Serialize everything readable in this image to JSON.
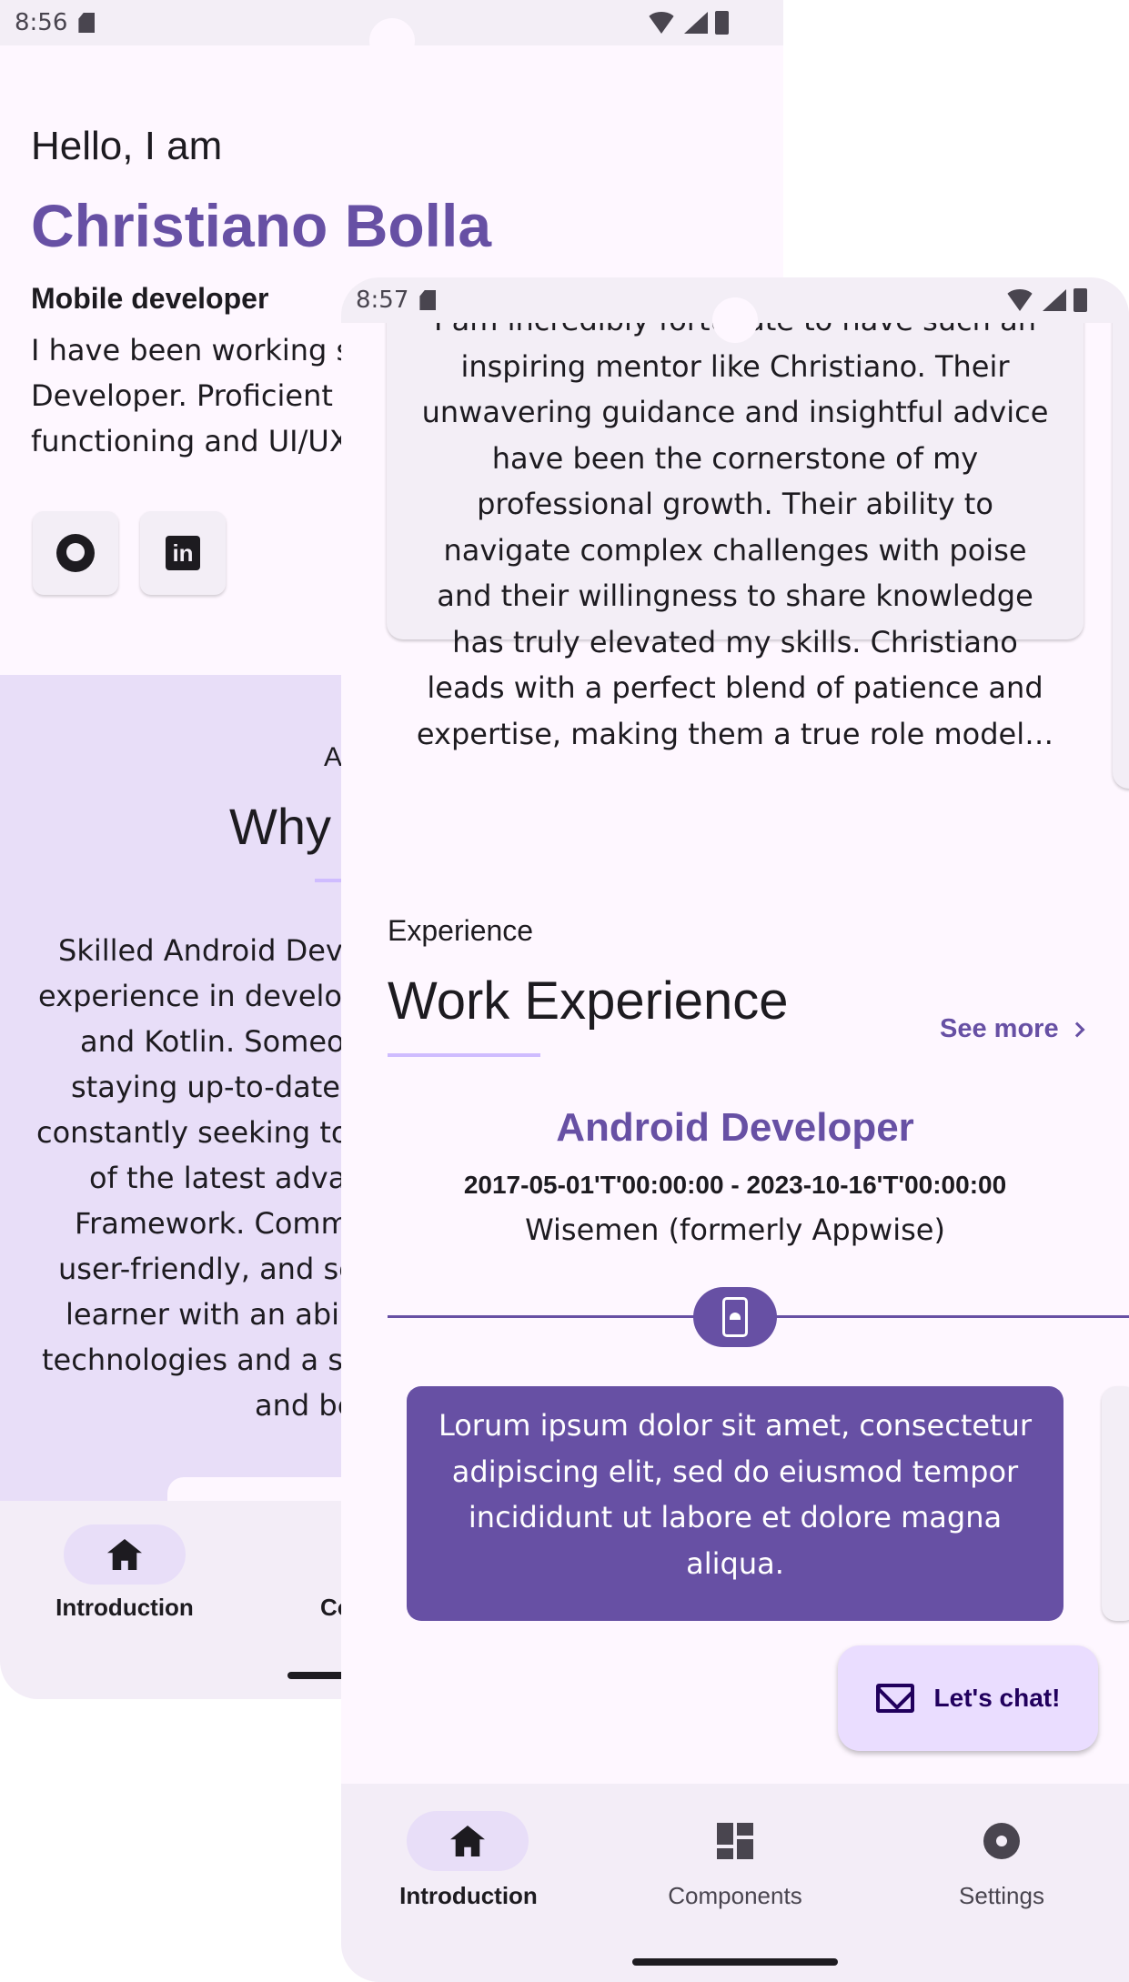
{
  "phone1": {
    "status": {
      "time": "8:56"
    },
    "intro": {
      "greeting": "Hello, I am",
      "name": "Christiano Bolla",
      "role": "Mobile developer",
      "bio": "I have been working s\nDeveloper. Proficient\nfunctioning and UI/UX"
    },
    "social": [
      {
        "icon": "github-icon"
      },
      {
        "icon": "linkedin-icon",
        "glyph": "in"
      }
    ],
    "about": {
      "label": "A",
      "title": "Why",
      "lines": [
        "Skilled Android Dev",
        "experience in develop",
        "and Kotlin. Someo",
        "staying up-to-date v",
        "constantly seeking to",
        "of the latest adva",
        "Framework. Comm",
        "user-friendly, and sc",
        "learner with an abil",
        "technologies and a s",
        "and be"
      ]
    },
    "nav": {
      "introduction": "Introduction",
      "components_partial": "Co"
    }
  },
  "phone2": {
    "status": {
      "time": "8:57"
    },
    "testimonial": {
      "text": "I am incredibly fortunate to have such an\ninspiring mentor like Christiano. Their\nunwavering guidance and insightful advice\nhave been the cornerstone of my\nprofessional growth. Their ability to\nnavigate complex challenges with poise\nand their willingness to share knowledge\nhas truly elevated my skills. Christiano\nleads with a perfect blend of patience and\nexpertise, making them a true role model…"
    },
    "experience": {
      "label": "Experience",
      "title": "Work Experience",
      "see_more": "See more",
      "job": {
        "title": "Android Developer",
        "dates": "2017-05-01'T'00:00:00 - 2023-10-16'T'00:00:00",
        "company": "Wisemen (formerly Appwise)",
        "description": "Lorum ipsum dolor sit amet, consectetur\nadipiscing elit, sed do eiusmod tempor\nincididunt ut labore et dolore magna\naliqua."
      }
    },
    "fab": {
      "label": "Let's chat!"
    },
    "nav": {
      "items": [
        {
          "label": "Introduction",
          "icon": "home-icon",
          "selected": true
        },
        {
          "label": "Components",
          "icon": "dashboard-icon",
          "selected": false
        },
        {
          "label": "Settings",
          "icon": "gear-icon",
          "selected": false
        }
      ]
    }
  },
  "colors": {
    "primary": "#6750a4",
    "primary_container": "#e8def8",
    "surface": "#fef7ff",
    "surface_container": "#f3edf7",
    "on_surface": "#1d1b20",
    "fab_container": "#eaddff"
  }
}
